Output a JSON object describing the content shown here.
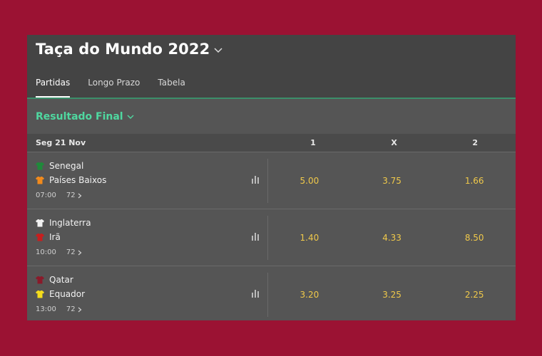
{
  "header": {
    "title": "Taça do Mundo 2022",
    "tabs": [
      "Partidas",
      "Longo Prazo",
      "Tabela"
    ]
  },
  "market": {
    "label": "Resultado Final"
  },
  "columns": {
    "date": "Seg 21 Nov",
    "one": "1",
    "draw": "X",
    "two": "2"
  },
  "matches": [
    {
      "home": "Senegal",
      "away": "Países Baixos",
      "home_shirt": "#1f8a3a",
      "away_shirt": "#f28a1c",
      "time": "07:00",
      "markets": "72",
      "odds": [
        "5.00",
        "3.75",
        "1.66"
      ]
    },
    {
      "home": "Inglaterra",
      "away": "Irã",
      "home_shirt": "#f2f2f2",
      "away_shirt": "#c81e1e",
      "time": "10:00",
      "markets": "72",
      "odds": [
        "1.40",
        "4.33",
        "8.50"
      ]
    },
    {
      "home": "Qatar",
      "away": "Equador",
      "home_shirt": "#8a1a2a",
      "away_shirt": "#f4dc1c",
      "time": "13:00",
      "markets": "72",
      "odds": [
        "3.20",
        "3.25",
        "2.25"
      ]
    }
  ]
}
